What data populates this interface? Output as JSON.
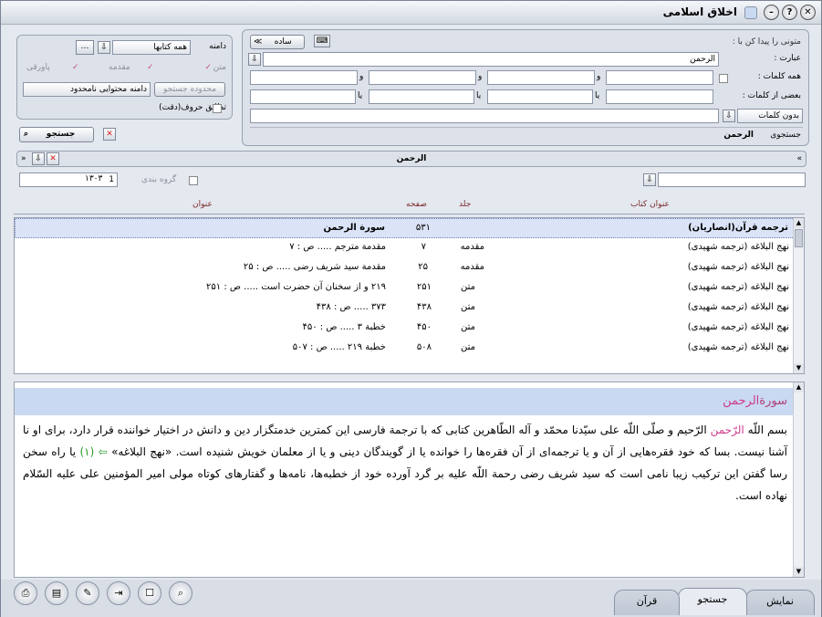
{
  "window": {
    "title": "اخلاق اسلامی",
    "controls": [
      "close-icon",
      "help-icon",
      "minimize-icon"
    ]
  },
  "search_panel": {
    "find_label": "متونی را پیدا کن با :",
    "phrase_label": "عبارت :",
    "phrase_value": "الرحمن",
    "all_words_label": "همه کلمات :",
    "some_words_label": "بعضی از کلمات :",
    "and_label": "و",
    "or_label": "یا",
    "without_words_value": "بدون کلمات",
    "mode_button": "ساده",
    "search_in_label": "جستجوی",
    "search_in_value": "الرحمن",
    "search_button": "جستجو"
  },
  "scope_panel": {
    "scope_label": "دامنه",
    "scope_value": "همه کتابها",
    "text_label": "متن",
    "intro_label": "مقدمه",
    "footnote_label": "پاورقی",
    "range_button": "محدوده جستجو",
    "range_value": "دامنه محتوایی نامحدود",
    "exact_match_label": "تطابق حروف(دقت)"
  },
  "results_bar": {
    "title": "الرحمن",
    "group_label": "گروه بندی",
    "count_value": "۱۳۰۳",
    "page_value": "1"
  },
  "grid": {
    "headers": {
      "book_title": "عنوان کتاب",
      "volume": "جلد",
      "page": "صفحه",
      "heading": "عنوان"
    },
    "rows": [
      {
        "book": "ترجمه قرآن(انصاریان)",
        "volume": "",
        "page": "۵۳۱",
        "heading": "سورة الرحمن"
      },
      {
        "book": "نهج البلاغه (ترجمه شهیدی)",
        "volume": "مقدمه",
        "page": "۷",
        "heading": "مقدمة مترجم ..... ص : ۷"
      },
      {
        "book": "نهج البلاغه (ترجمه شهیدی)",
        "volume": "مقدمه",
        "page": "۲۵",
        "heading": "مقدمة سيد شريف رضى ..... ص : ۲۵"
      },
      {
        "book": "نهج البلاغه (ترجمه شهیدی)",
        "volume": "متن",
        "page": "۲۵۱",
        "heading": "۲۱۹ و از سخنان آن حضرت است ..... ص : ۲۵۱"
      },
      {
        "book": "نهج البلاغه (ترجمه شهیدی)",
        "volume": "متن",
        "page": "۴۳۸",
        "heading": "۳۷۳ ..... ص : ۴۳۸"
      },
      {
        "book": "نهج البلاغه (ترجمه شهیدی)",
        "volume": "متن",
        "page": "۴۵۰",
        "heading": "خطبة ۳ ..... ص : ۴۵۰"
      },
      {
        "book": "نهج البلاغه (ترجمه شهیدی)",
        "volume": "متن",
        "page": "۵۰۸",
        "heading": "خطبة ۲۱۹ ..... ص : ۵۰۷"
      }
    ]
  },
  "text_pane": {
    "heading_prefix": "سورة",
    "heading_word": "الرحمن",
    "p1_a": "بسم اللّه ",
    "p1_hl": "الرّحمن",
    "p1_b": " الرّحيم و صلّى اللّه على سيّدنا محمّد و آله الطّاهرين كتابى كه با ترجمة فارسى اين كمترين خدمتگزار دين و دانش در اختيار خواننده قرار دارد، براى او نا آشنا نيست. بسا كه خود فقره‌هايى از آن و يا ترجمه‌اى از آن فقره‌ها را خوانده يا از گويندگان دينى و يا از معلمان خويش شنيده است. «نهج البلاغه»",
    "p1_c": " يا راه سخن رسا گفتن اين تركيب زيبا نامى است كه سيد شريف رضى رحمة اللّه عليه بر گرد آورده خود از خطبه‌ها، نامه‌ها و گفتارهاى كوتاه مولى امير المؤمنين على عليه السّلام نهاده است.",
    "note_mark": "(۱)"
  },
  "tabs": [
    "نمایش",
    "جستجو",
    "قرآن"
  ],
  "active_tab": "جستجو",
  "toolbar_icons": [
    "print-icon",
    "book-icon",
    "edit-icon",
    "export-icon",
    "note-icon",
    "zoom-icon"
  ]
}
